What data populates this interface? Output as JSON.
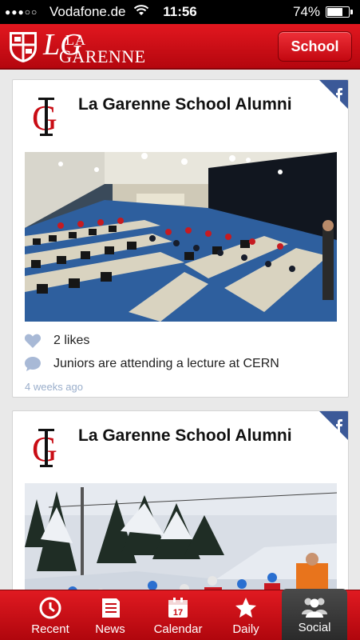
{
  "status_bar": {
    "signal_dots": "●●●○○",
    "carrier": "Vodafone.de",
    "time": "11:56",
    "battery_percent": "74%",
    "battery_level": 0.74
  },
  "header": {
    "logo_monogram": "LG",
    "logo_la": "LA",
    "logo_name": "GARENNE",
    "school_button_label": "School"
  },
  "feed": {
    "posts": [
      {
        "author": "La Garenne School Alumni",
        "likes": "2 likes",
        "caption": "Juniors are attending a lecture at CERN",
        "time_ago": "4 weeks ago"
      },
      {
        "author": "La Garenne School Alumni"
      }
    ]
  },
  "tabbar": {
    "tabs": [
      {
        "label": "Recent",
        "icon": "clock-icon"
      },
      {
        "label": "News",
        "icon": "newspaper-icon"
      },
      {
        "label": "Calendar",
        "icon": "calendar-icon",
        "badge": "17"
      },
      {
        "label": "Daily",
        "icon": "star-icon"
      },
      {
        "label": "Social",
        "icon": "people-icon",
        "active": true
      }
    ]
  },
  "colors": {
    "brand_red": "#d20f17",
    "facebook_blue": "#3b5998",
    "tab_active": "#333333"
  }
}
